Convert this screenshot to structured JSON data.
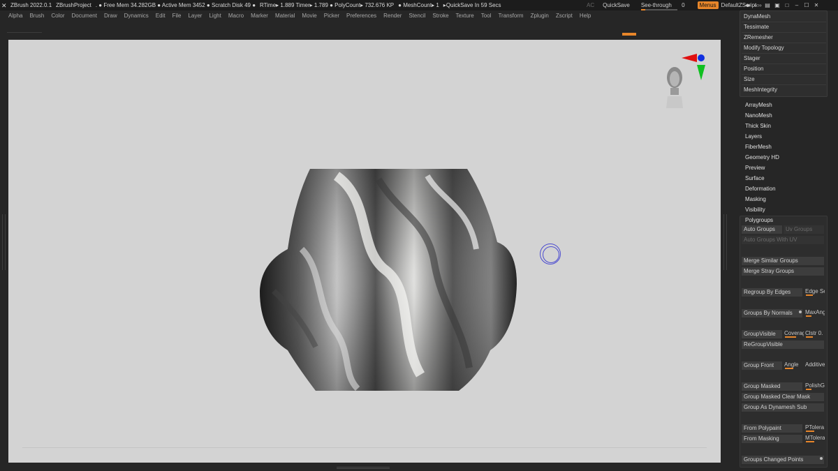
{
  "titlebar": {
    "items": [
      "ZBrush 2022.0.1",
      "ZBrushProject",
      ". ● Free Mem 34.282GB ● Active Mem 3452 ● Scratch Disk 49 ●",
      "RTime▸ 1.889 Timer▸ 1.789 ● PolyCount▸ 732.676 KP",
      "● MeshCount▸ 1",
      "▸QuickSave In 59 Secs"
    ],
    "ac": "AC",
    "quicksave": "QuickSave",
    "see_through": "See-through",
    "see_through_value": "0",
    "see_through_fraction": 0.0,
    "menus": "Menus",
    "script": "DefaultZScript",
    "window_icons": [
      "◂▸",
      "‹‹››",
      "▤",
      "▣",
      "□",
      "–",
      "☐",
      "✕"
    ]
  },
  "menubar": [
    "Alpha",
    "Brush",
    "Color",
    "Document",
    "Draw",
    "Dynamics",
    "Edit",
    "File",
    "Layer",
    "Light",
    "Macro",
    "Marker",
    "Material",
    "Movie",
    "Picker",
    "Preferences",
    "Render",
    "Stencil",
    "Stroke",
    "Texture",
    "Tool",
    "Transform",
    "Zplugin",
    "Zscript",
    "Help"
  ],
  "geometry_menu": [
    "DynaMesh",
    "Tessimate",
    "ZRemesher",
    "Modify Topology",
    "Stager",
    "Position",
    "Size",
    "MeshIntegrity"
  ],
  "subpalettes": [
    "ArrayMesh",
    "NanoMesh",
    "Thick Skin",
    "Layers",
    "FiberMesh",
    "Geometry HD",
    "Preview",
    "Surface",
    "Deformation",
    "Masking",
    "Visibility",
    "Polygroups"
  ],
  "polygroups": {
    "auto_groups": "Auto Groups",
    "uv_groups": "Uv Groups",
    "auto_groups_with_uv": "Auto Groups With UV",
    "merge_similar": "Merge Similar Groups",
    "merge_stray": "Merge Stray Groups",
    "regroup_by_edges": "Regroup By Edges",
    "edge_se": "Edge Se",
    "groups_by_normals": "Groups By Normals",
    "max_an": "MaxAng",
    "group_visible": "GroupVisible",
    "coverage": "Coverag",
    "clstr": "Clstr 0.",
    "regroup_visible": "ReGroupVisible",
    "group_front": "Group Front",
    "angle": "Angle",
    "additive": "Additive",
    "group_masked": "Group Masked",
    "polishg": "PolishG",
    "group_masked_clear": "Group Masked Clear Mask",
    "group_as_dynamesh": "Group As Dynamesh Sub",
    "from_polypaint": "From Polypaint",
    "ptolera": "PTolera",
    "from_masking": "From Masking",
    "mtolera": "MTolera",
    "groups_changed_points": "Groups Changed Points"
  },
  "colors": {
    "accent": "#e8862a",
    "background": "#262626",
    "canvas": "#d3d3d3",
    "gizmo_x": "#e01010",
    "gizmo_y": "#10c020",
    "gizmo_z": "#1030e0"
  },
  "icons": [
    "zbrush-logo-icon",
    "head-navigation-icon",
    "axis-gizmo-icon",
    "brush-cursor-icon"
  ]
}
